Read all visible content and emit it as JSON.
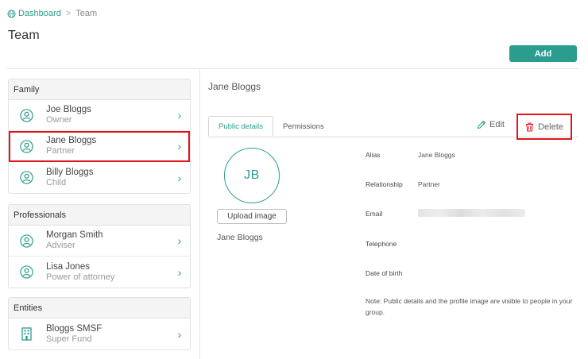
{
  "breadcrumb": {
    "home": "Dashboard",
    "separator": ">",
    "current": "Team"
  },
  "page_title": "Team",
  "add_button": "Add",
  "groups": [
    {
      "title": "Family",
      "members": [
        {
          "name": "Joe Bloggs",
          "role": "Owner",
          "icon": "person-icon"
        },
        {
          "name": "Jane Bloggs",
          "role": "Partner",
          "icon": "person-icon",
          "selected": true
        },
        {
          "name": "Billy Bloggs",
          "role": "Child",
          "icon": "person-icon"
        }
      ]
    },
    {
      "title": "Professionals",
      "members": [
        {
          "name": "Morgan Smith",
          "role": "Adviser",
          "icon": "person-icon"
        },
        {
          "name": "Lisa Jones",
          "role": "Power of attorney",
          "icon": "person-icon"
        }
      ]
    },
    {
      "title": "Entities",
      "members": [
        {
          "name": "Bloggs SMSF",
          "role": "Super Fund",
          "icon": "building-icon"
        }
      ]
    }
  ],
  "detail": {
    "name": "Jane Bloggs",
    "tabs": [
      "Public details",
      "Permissions"
    ],
    "active_tab": "Public details",
    "edit_label": "Edit",
    "delete_label": "Delete",
    "initials": "JB",
    "upload_label": "Upload image",
    "photo_name": "Jane Bloggs",
    "fields": [
      {
        "label": "Alias",
        "value": "Jane Bloggs"
      },
      {
        "label": "Relationship",
        "value": "Partner"
      },
      {
        "label": "Email",
        "value": "",
        "redacted": true
      },
      {
        "label": "Telephone",
        "value": ""
      },
      {
        "label": "Date of birth",
        "value": ""
      }
    ],
    "note": "Note: Public details and the profile image are visible to people in your group."
  },
  "colors": {
    "accent": "#2a9d8f",
    "highlight": "#e0141b",
    "delete_icon": "#e0141b"
  }
}
